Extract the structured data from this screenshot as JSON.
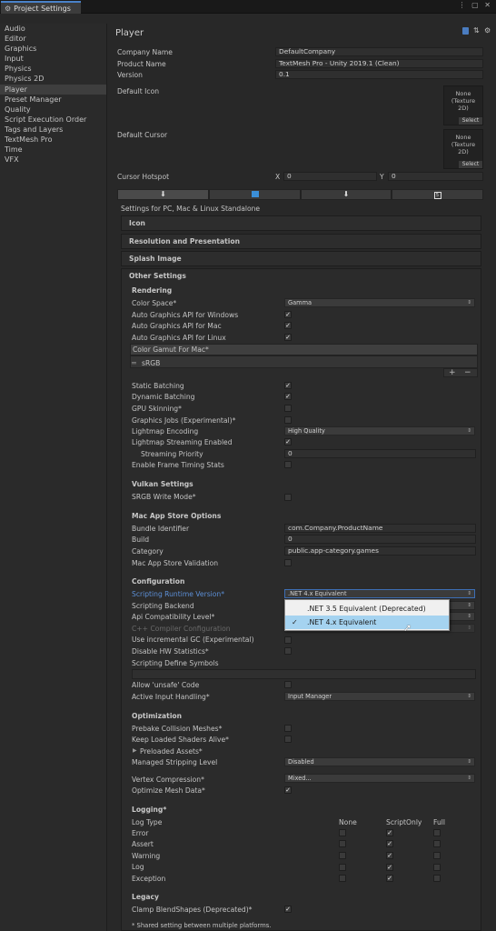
{
  "window": {
    "tab_title": "Project Settings",
    "controls": "⋮ ▢ ✕"
  },
  "sidebar": {
    "items": [
      "Audio",
      "Editor",
      "Graphics",
      "Input",
      "Physics",
      "Physics 2D",
      "Player",
      "Preset Manager",
      "Quality",
      "Script Execution Order",
      "Tags and Layers",
      "TextMesh Pro",
      "Time",
      "VFX"
    ],
    "selected": "Player"
  },
  "header": {
    "title": "Player",
    "icons": [
      "book-icon",
      "sliders-icon",
      "gear-icon"
    ]
  },
  "company": {
    "label": "Company Name",
    "value": "DefaultCompany"
  },
  "product": {
    "label": "Product Name",
    "value": "TextMesh Pro - Unity 2019.1 (Clean)"
  },
  "version": {
    "label": "Version",
    "value": "0.1"
  },
  "default_icon": {
    "label": "Default Icon",
    "box": [
      "None",
      "(Texture",
      "2D)"
    ],
    "select": "Select"
  },
  "default_cursor": {
    "label": "Default Cursor",
    "box": [
      "None",
      "(Texture",
      "2D)"
    ],
    "select": "Select"
  },
  "hotspot": {
    "label": "Cursor Hotspot",
    "x_label": "X",
    "x": "0",
    "y_label": "Y",
    "y": "0"
  },
  "platform_tabs": [
    "standalone-icon",
    "windows-store-icon",
    "android-icon",
    "webgl-icon"
  ],
  "settings_for": "Settings for PC, Mac & Linux Standalone",
  "foldouts": {
    "icon": "Icon",
    "resolution": "Resolution and Presentation",
    "splash": "Splash Image",
    "other": "Other Settings"
  },
  "rendering": {
    "header": "Rendering",
    "color_space": {
      "label": "Color Space*",
      "value": "Gamma"
    },
    "auto_win": {
      "label": "Auto Graphics API  for Windows",
      "checked": true
    },
    "auto_mac": {
      "label": "Auto Graphics API  for Mac",
      "checked": true
    },
    "auto_linux": {
      "label": "Auto Graphics API  for Linux",
      "checked": true
    },
    "gamut_header": "Color Gamut For Mac*",
    "gamut_item": "sRGB",
    "plus": "+",
    "minus": "−",
    "static_batching": {
      "label": "Static Batching",
      "checked": true
    },
    "dynamic_batching": {
      "label": "Dynamic Batching",
      "checked": true
    },
    "gpu_skinning": {
      "label": "GPU Skinning*",
      "checked": false
    },
    "graphics_jobs": {
      "label": "Graphics Jobs (Experimental)*",
      "checked": false
    },
    "lightmap_encoding": {
      "label": "Lightmap Encoding",
      "value": "High Quality"
    },
    "lightmap_streaming": {
      "label": "Lightmap Streaming Enabled",
      "checked": true
    },
    "streaming_priority": {
      "label": "Streaming Priority",
      "value": "0"
    },
    "frame_timing": {
      "label": "Enable Frame Timing Stats",
      "checked": false
    }
  },
  "vulkan": {
    "header": "Vulkan Settings",
    "srgb": {
      "label": "SRGB Write Mode*",
      "checked": false
    }
  },
  "macstore": {
    "header": "Mac App Store Options",
    "bundle": {
      "label": "Bundle Identifier",
      "value": "com.Company.ProductName"
    },
    "build": {
      "label": "Build",
      "value": "0"
    },
    "category": {
      "label": "Category",
      "value": "public.app-category.games"
    },
    "validation": {
      "label": "Mac App Store Validation",
      "checked": false
    }
  },
  "configuration": {
    "header": "Configuration",
    "runtime": {
      "label": "Scripting Runtime Version*",
      "value": ".NET 4.x Equivalent"
    },
    "backend": {
      "label": "Scripting Backend"
    },
    "api": {
      "label": "Api Compatibility Level*"
    },
    "cpp": {
      "label": "C++ Compiler Configuration"
    },
    "incremental_gc": {
      "label": "Use incremental GC (Experimental)",
      "checked": false
    },
    "hw_stats": {
      "label": "Disable HW Statistics*",
      "checked": false
    },
    "define_symbols": {
      "label": "Scripting Define Symbols",
      "value": ""
    },
    "unsafe": {
      "label": "Allow 'unsafe' Code",
      "checked": false
    },
    "input_handling": {
      "label": "Active Input Handling*",
      "value": "Input Manager"
    }
  },
  "popup": {
    "options": [
      ".NET 3.5 Equivalent (Deprecated)",
      ".NET 4.x Equivalent"
    ],
    "selected_index": 1
  },
  "optimization": {
    "header": "Optimization",
    "prebake": {
      "label": "Prebake Collision Meshes*",
      "checked": false
    },
    "keep_shaders": {
      "label": "Keep Loaded Shaders Alive*",
      "checked": false
    },
    "preloaded": {
      "label": "Preloaded Assets*"
    },
    "stripping": {
      "label": "Managed Stripping Level",
      "value": "Disabled"
    },
    "vertex": {
      "label": "Vertex Compression*",
      "value": "Mixed..."
    },
    "optimize_mesh": {
      "label": "Optimize Mesh Data*",
      "checked": true
    }
  },
  "logging": {
    "header": "Logging*",
    "columns": [
      "Log Type",
      "None",
      "ScriptOnly",
      "Full"
    ],
    "rows": [
      {
        "label": "Error",
        "none": false,
        "script": true,
        "full": false
      },
      {
        "label": "Assert",
        "none": false,
        "script": true,
        "full": false
      },
      {
        "label": "Warning",
        "none": false,
        "script": true,
        "full": false
      },
      {
        "label": "Log",
        "none": false,
        "script": true,
        "full": false
      },
      {
        "label": "Exception",
        "none": false,
        "script": true,
        "full": false
      }
    ]
  },
  "legacy": {
    "header": "Legacy",
    "clamp": {
      "label": "Clamp BlendShapes (Deprecated)*",
      "checked": true
    }
  },
  "footnote": "* Shared setting between multiple platforms."
}
